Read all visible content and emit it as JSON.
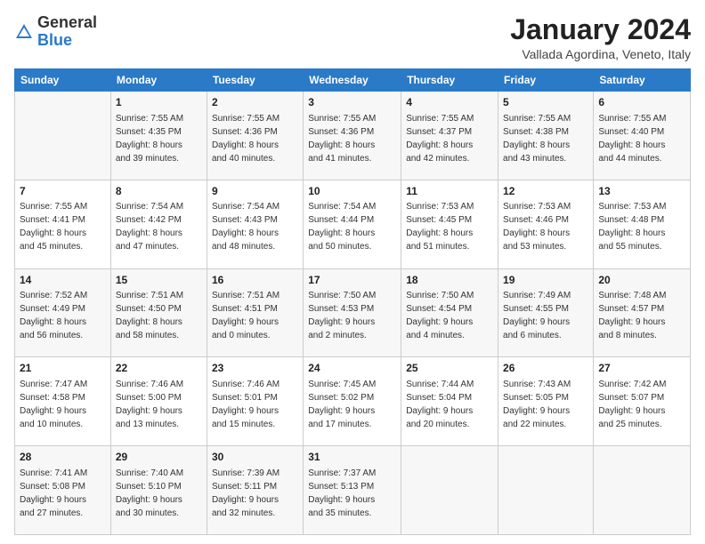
{
  "header": {
    "logo_general": "General",
    "logo_blue": "Blue",
    "month_title": "January 2024",
    "subtitle": "Vallada Agordina, Veneto, Italy"
  },
  "weekdays": [
    "Sunday",
    "Monday",
    "Tuesday",
    "Wednesday",
    "Thursday",
    "Friday",
    "Saturday"
  ],
  "weeks": [
    [
      {
        "day": null,
        "info": null
      },
      {
        "day": "1",
        "info": "Sunrise: 7:55 AM\nSunset: 4:35 PM\nDaylight: 8 hours\nand 39 minutes."
      },
      {
        "day": "2",
        "info": "Sunrise: 7:55 AM\nSunset: 4:36 PM\nDaylight: 8 hours\nand 40 minutes."
      },
      {
        "day": "3",
        "info": "Sunrise: 7:55 AM\nSunset: 4:36 PM\nDaylight: 8 hours\nand 41 minutes."
      },
      {
        "day": "4",
        "info": "Sunrise: 7:55 AM\nSunset: 4:37 PM\nDaylight: 8 hours\nand 42 minutes."
      },
      {
        "day": "5",
        "info": "Sunrise: 7:55 AM\nSunset: 4:38 PM\nDaylight: 8 hours\nand 43 minutes."
      },
      {
        "day": "6",
        "info": "Sunrise: 7:55 AM\nSunset: 4:40 PM\nDaylight: 8 hours\nand 44 minutes."
      }
    ],
    [
      {
        "day": "7",
        "info": "Sunrise: 7:55 AM\nSunset: 4:41 PM\nDaylight: 8 hours\nand 45 minutes."
      },
      {
        "day": "8",
        "info": "Sunrise: 7:54 AM\nSunset: 4:42 PM\nDaylight: 8 hours\nand 47 minutes."
      },
      {
        "day": "9",
        "info": "Sunrise: 7:54 AM\nSunset: 4:43 PM\nDaylight: 8 hours\nand 48 minutes."
      },
      {
        "day": "10",
        "info": "Sunrise: 7:54 AM\nSunset: 4:44 PM\nDaylight: 8 hours\nand 50 minutes."
      },
      {
        "day": "11",
        "info": "Sunrise: 7:53 AM\nSunset: 4:45 PM\nDaylight: 8 hours\nand 51 minutes."
      },
      {
        "day": "12",
        "info": "Sunrise: 7:53 AM\nSunset: 4:46 PM\nDaylight: 8 hours\nand 53 minutes."
      },
      {
        "day": "13",
        "info": "Sunrise: 7:53 AM\nSunset: 4:48 PM\nDaylight: 8 hours\nand 55 minutes."
      }
    ],
    [
      {
        "day": "14",
        "info": "Sunrise: 7:52 AM\nSunset: 4:49 PM\nDaylight: 8 hours\nand 56 minutes."
      },
      {
        "day": "15",
        "info": "Sunrise: 7:51 AM\nSunset: 4:50 PM\nDaylight: 8 hours\nand 58 minutes."
      },
      {
        "day": "16",
        "info": "Sunrise: 7:51 AM\nSunset: 4:51 PM\nDaylight: 9 hours\nand 0 minutes."
      },
      {
        "day": "17",
        "info": "Sunrise: 7:50 AM\nSunset: 4:53 PM\nDaylight: 9 hours\nand 2 minutes."
      },
      {
        "day": "18",
        "info": "Sunrise: 7:50 AM\nSunset: 4:54 PM\nDaylight: 9 hours\nand 4 minutes."
      },
      {
        "day": "19",
        "info": "Sunrise: 7:49 AM\nSunset: 4:55 PM\nDaylight: 9 hours\nand 6 minutes."
      },
      {
        "day": "20",
        "info": "Sunrise: 7:48 AM\nSunset: 4:57 PM\nDaylight: 9 hours\nand 8 minutes."
      }
    ],
    [
      {
        "day": "21",
        "info": "Sunrise: 7:47 AM\nSunset: 4:58 PM\nDaylight: 9 hours\nand 10 minutes."
      },
      {
        "day": "22",
        "info": "Sunrise: 7:46 AM\nSunset: 5:00 PM\nDaylight: 9 hours\nand 13 minutes."
      },
      {
        "day": "23",
        "info": "Sunrise: 7:46 AM\nSunset: 5:01 PM\nDaylight: 9 hours\nand 15 minutes."
      },
      {
        "day": "24",
        "info": "Sunrise: 7:45 AM\nSunset: 5:02 PM\nDaylight: 9 hours\nand 17 minutes."
      },
      {
        "day": "25",
        "info": "Sunrise: 7:44 AM\nSunset: 5:04 PM\nDaylight: 9 hours\nand 20 minutes."
      },
      {
        "day": "26",
        "info": "Sunrise: 7:43 AM\nSunset: 5:05 PM\nDaylight: 9 hours\nand 22 minutes."
      },
      {
        "day": "27",
        "info": "Sunrise: 7:42 AM\nSunset: 5:07 PM\nDaylight: 9 hours\nand 25 minutes."
      }
    ],
    [
      {
        "day": "28",
        "info": "Sunrise: 7:41 AM\nSunset: 5:08 PM\nDaylight: 9 hours\nand 27 minutes."
      },
      {
        "day": "29",
        "info": "Sunrise: 7:40 AM\nSunset: 5:10 PM\nDaylight: 9 hours\nand 30 minutes."
      },
      {
        "day": "30",
        "info": "Sunrise: 7:39 AM\nSunset: 5:11 PM\nDaylight: 9 hours\nand 32 minutes."
      },
      {
        "day": "31",
        "info": "Sunrise: 7:37 AM\nSunset: 5:13 PM\nDaylight: 9 hours\nand 35 minutes."
      },
      {
        "day": null,
        "info": null
      },
      {
        "day": null,
        "info": null
      },
      {
        "day": null,
        "info": null
      }
    ]
  ]
}
